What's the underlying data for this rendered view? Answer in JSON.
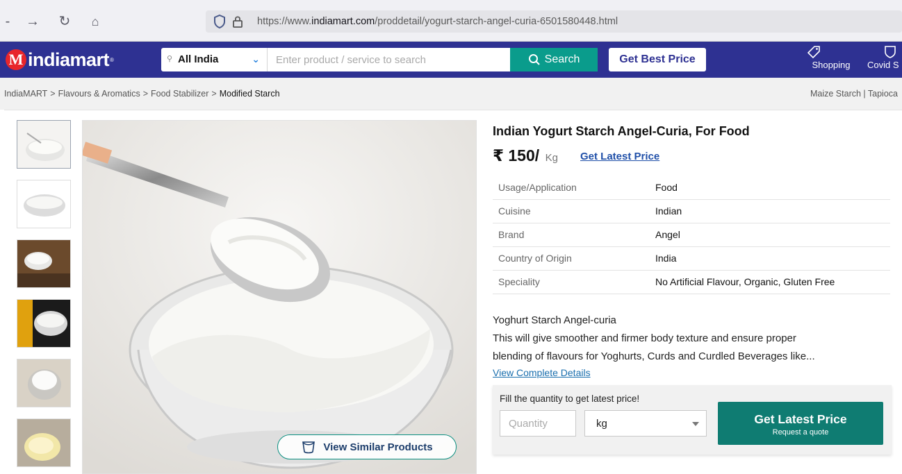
{
  "browser": {
    "url_prefix": "https://www.",
    "url_domain": "indiamart.com",
    "url_path": "/proddetail/yogurt-starch-angel-curia-6501580448.html"
  },
  "header": {
    "logo_text": "indiamart",
    "logo_letter": "M",
    "location": "All India",
    "search_placeholder": "Enter product / service to search",
    "search_button": "Search",
    "get_best_price": "Get Best Price",
    "shopping_label": "Shopping",
    "covid_label": "Covid S",
    "brand_color": "#2e3192",
    "accent_color": "#0a9c8c"
  },
  "breadcrumb": {
    "items": [
      "IndiaMART",
      "Flavours & Aromatics",
      "Food Stabilizer",
      "Modified Starch"
    ],
    "separator": ">",
    "related": [
      "Maize Starch",
      "Tapioca"
    ]
  },
  "product": {
    "title": "Indian Yogurt Starch Angel-Curia, For Food",
    "price": "₹ 150/",
    "unit": "Kg",
    "latest_price_link": "Get Latest Price",
    "specs": [
      {
        "key": "Usage/Application",
        "value": "Food"
      },
      {
        "key": "Cuisine",
        "value": "Indian"
      },
      {
        "key": "Brand",
        "value": "Angel"
      },
      {
        "key": "Country of Origin",
        "value": "India"
      },
      {
        "key": "Speciality",
        "value": "No Artificial Flavour, Organic, Gluten Free"
      }
    ],
    "desc_title": "Yoghurt Starch Angel-curia",
    "desc_line1": "This will give smoother and firmer body texture and ensure proper",
    "desc_line2": "blending of flavours for Yoghurts, Curds and Curdled Beverages like...",
    "view_details": "View Complete Details",
    "view_similar": "View Similar Products"
  },
  "quote": {
    "label": "Fill the quantity to get latest price!",
    "quantity_placeholder": "Quantity",
    "unit_value": "kg",
    "button_title": "Get Latest Price",
    "button_sub": "Request a quote"
  }
}
